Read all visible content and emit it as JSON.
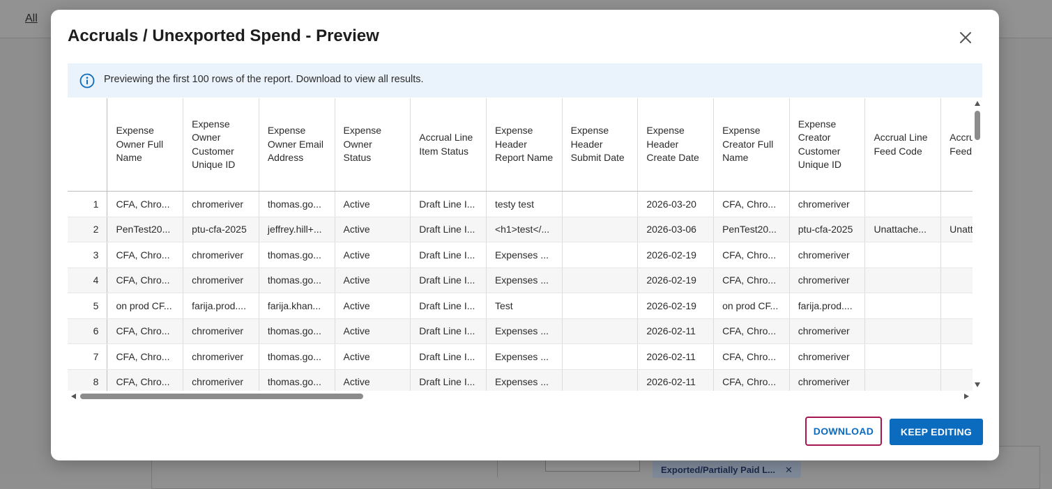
{
  "background": {
    "nav_link": "All",
    "chip_label": "Exported/Partially Paid L...",
    "chip_close": "✕"
  },
  "modal": {
    "title": "Accruals / Unexported Spend - Preview",
    "info_text": "Previewing the first 100 rows of the report. Download to view all results.",
    "buttons": {
      "download": "DOWNLOAD",
      "keep_editing": "KEEP EDITING"
    },
    "colors": {
      "primary": "#0b6bbf",
      "focus_outline": "#a3164f",
      "banner_bg": "#eaf3fb"
    }
  },
  "table": {
    "columns": [
      "",
      "Expense Owner Full Name",
      "Expense Owner Customer Unique ID",
      "Expense Owner Email Address",
      "Expense Owner Status",
      "Accrual Line Item Status",
      "Expense Header Report Name",
      "Expense Header Submit Date",
      "Expense Header Create Date",
      "Expense Creator Full Name",
      "Expense Creator Customer Unique ID",
      "Accrual Line Feed Code",
      "Accrual Line Feed Name"
    ],
    "rows": [
      [
        "1",
        "CFA, Chro...",
        "chromeriver",
        "thomas.go...",
        "Active",
        "Draft Line I...",
        "testy test",
        "",
        "2026-03-20",
        "CFA, Chro...",
        "chromeriver",
        "",
        ""
      ],
      [
        "2",
        "PenTest20...",
        "ptu-cfa-2025",
        "jeffrey.hill+...",
        "Active",
        "Draft Line I...",
        "<h1>test</...",
        "",
        "2026-03-06",
        "PenTest20...",
        "ptu-cfa-2025",
        "Unattache...",
        "Unattache..."
      ],
      [
        "3",
        "CFA, Chro...",
        "chromeriver",
        "thomas.go...",
        "Active",
        "Draft Line I...",
        "Expenses ...",
        "",
        "2026-02-19",
        "CFA, Chro...",
        "chromeriver",
        "",
        ""
      ],
      [
        "4",
        "CFA, Chro...",
        "chromeriver",
        "thomas.go...",
        "Active",
        "Draft Line I...",
        "Expenses ...",
        "",
        "2026-02-19",
        "CFA, Chro...",
        "chromeriver",
        "",
        ""
      ],
      [
        "5",
        "on prod CF...",
        "farija.prod....",
        "farija.khan...",
        "Active",
        "Draft Line I...",
        "Test",
        "",
        "2026-02-19",
        "on prod CF...",
        "farija.prod....",
        "",
        ""
      ],
      [
        "6",
        "CFA, Chro...",
        "chromeriver",
        "thomas.go...",
        "Active",
        "Draft Line I...",
        "Expenses ...",
        "",
        "2026-02-11",
        "CFA, Chro...",
        "chromeriver",
        "",
        ""
      ],
      [
        "7",
        "CFA, Chro...",
        "chromeriver",
        "thomas.go...",
        "Active",
        "Draft Line I...",
        "Expenses ...",
        "",
        "2026-02-11",
        "CFA, Chro...",
        "chromeriver",
        "",
        ""
      ],
      [
        "8",
        "CFA, Chro...",
        "chromeriver",
        "thomas.go...",
        "Active",
        "Draft Line I...",
        "Expenses ...",
        "",
        "2026-02-11",
        "CFA, Chro...",
        "chromeriver",
        "",
        ""
      ]
    ]
  }
}
